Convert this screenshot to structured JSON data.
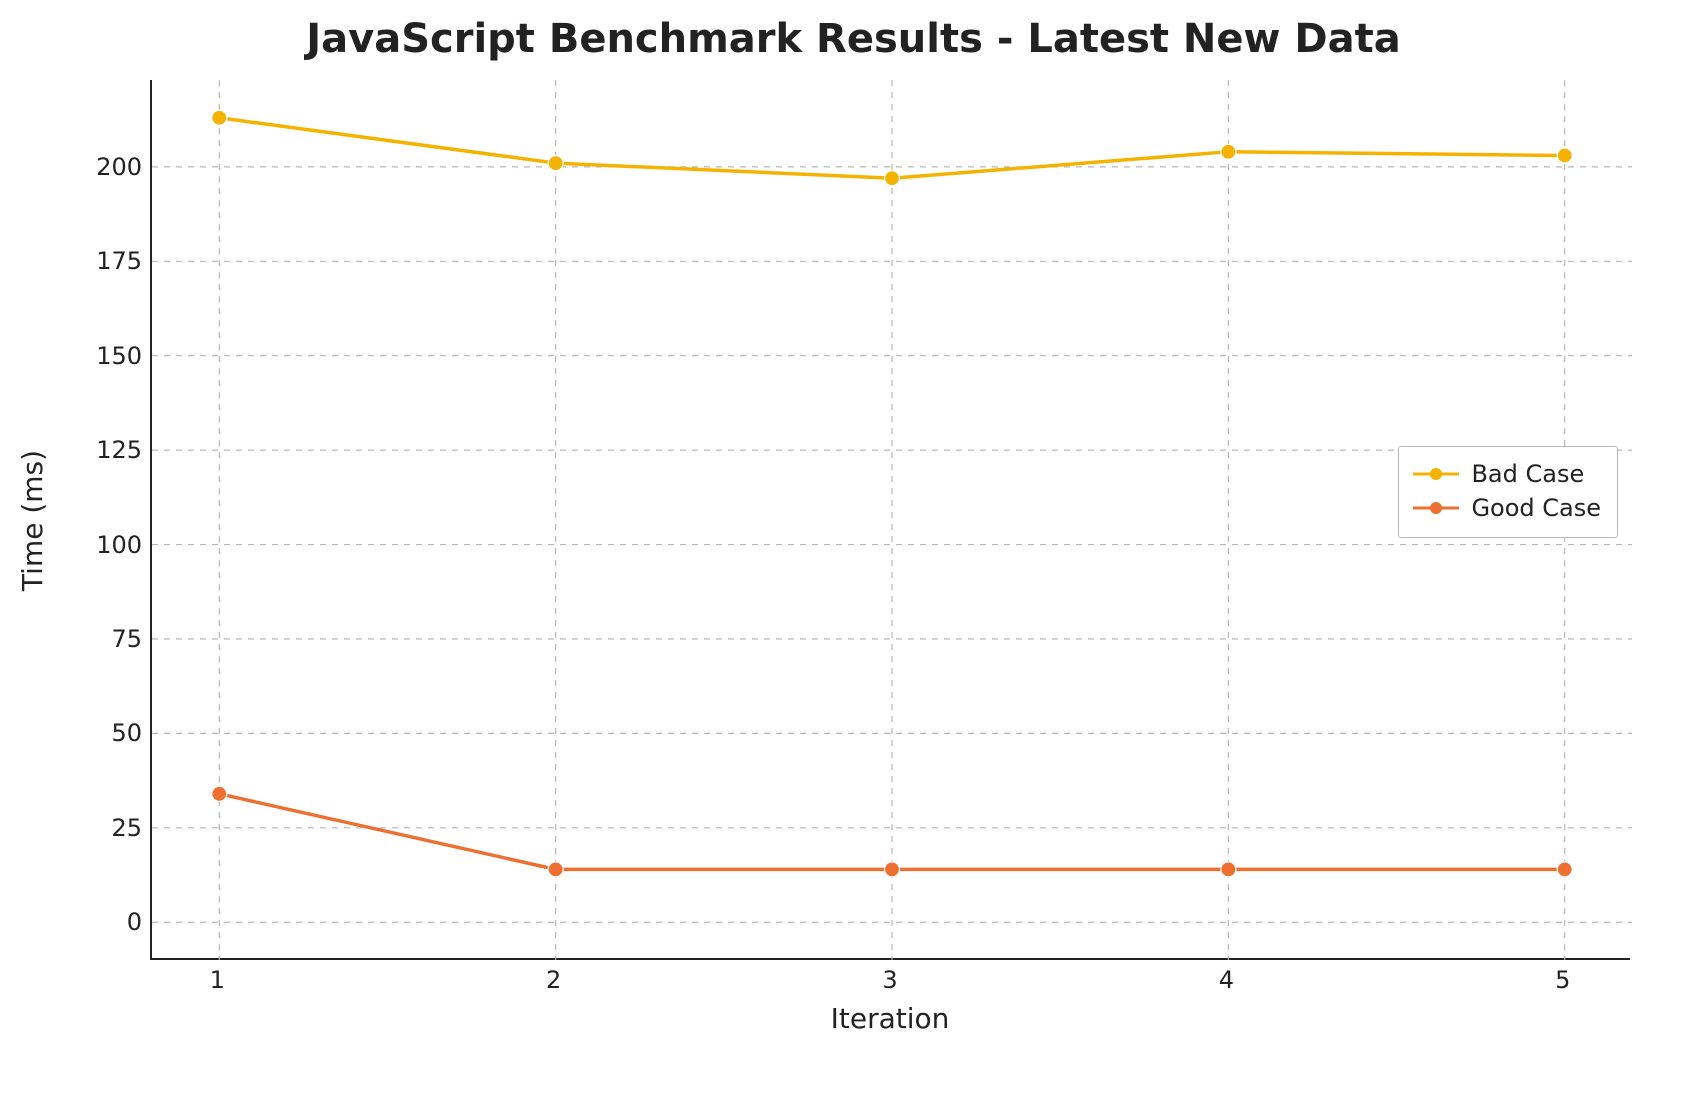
{
  "chart_data": {
    "type": "line",
    "title": "JavaScript Benchmark Results - Latest New Data",
    "xlabel": "Iteration",
    "ylabel": "Time (ms)",
    "x": [
      1,
      2,
      3,
      4,
      5
    ],
    "xlim": [
      0.8,
      5.2
    ],
    "ylim": [
      -10,
      223
    ],
    "yticks": [
      0,
      25,
      50,
      75,
      100,
      125,
      150,
      175,
      200
    ],
    "grid": true,
    "legend_position": "right",
    "series": [
      {
        "name": "Bad Case",
        "color": "#f5b301",
        "values": [
          213,
          201,
          197,
          204,
          203
        ]
      },
      {
        "name": "Good Case",
        "color": "#ee7031",
        "values": [
          34,
          14,
          14,
          14,
          14
        ]
      }
    ]
  }
}
